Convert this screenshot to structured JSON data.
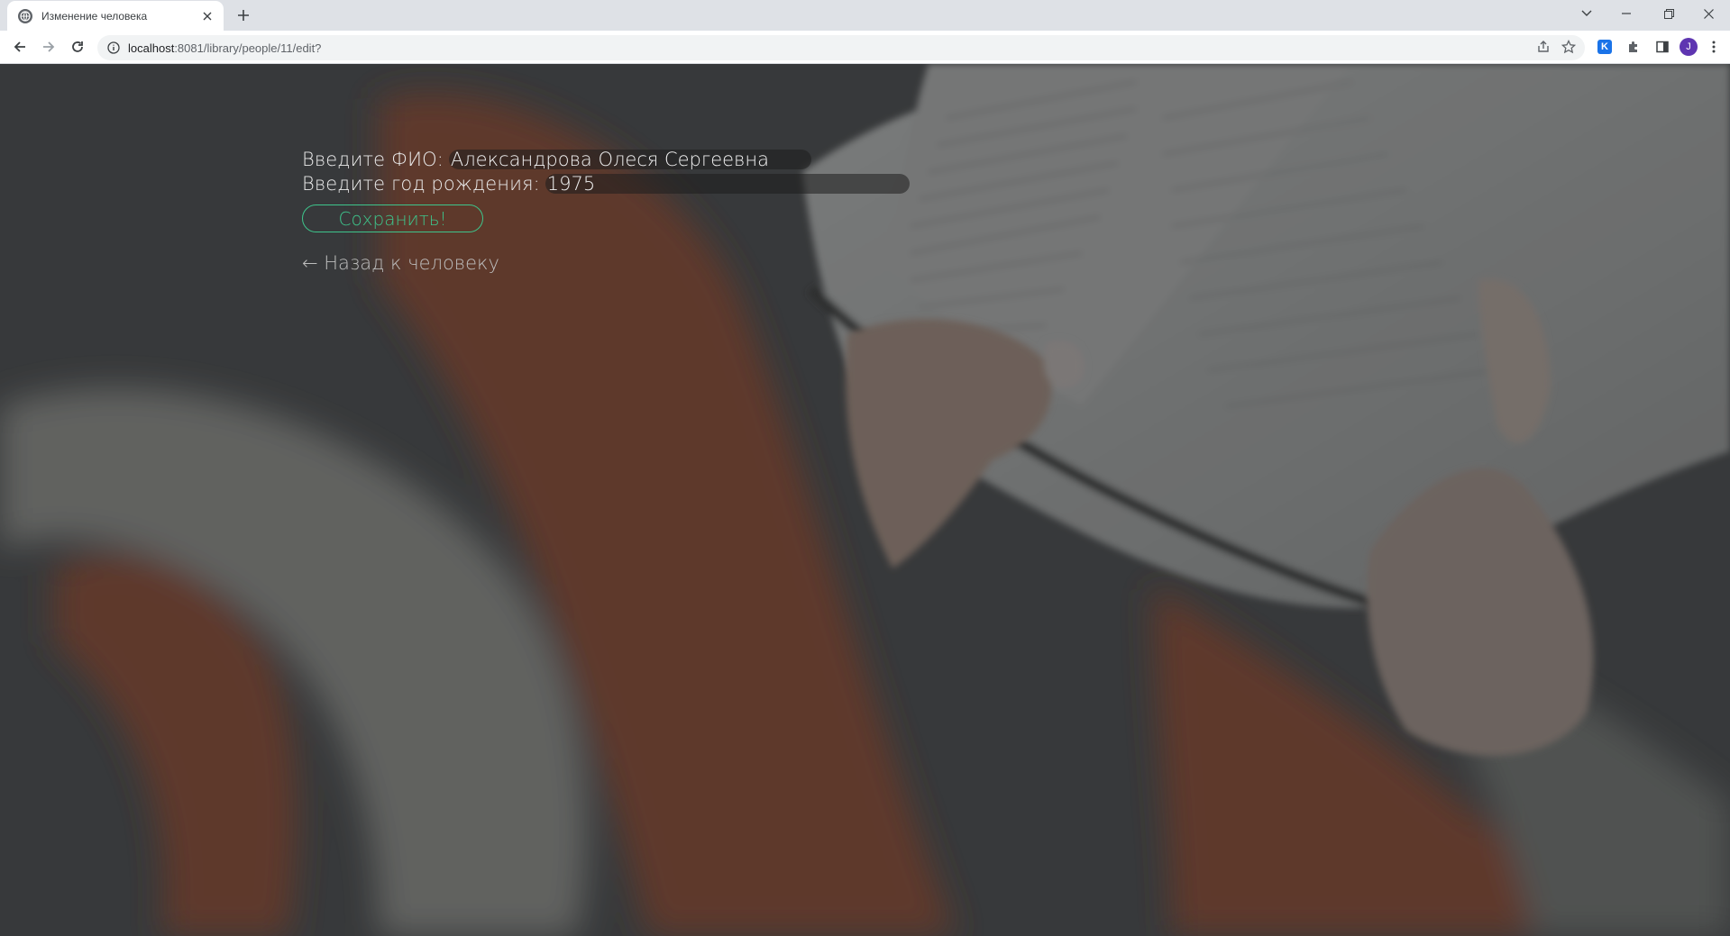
{
  "browser": {
    "tab": {
      "title": "Изменение человека"
    },
    "address": {
      "host": "localhost",
      "rest": ":8081/library/people/11/edit?"
    },
    "profile_initial": "J",
    "extension_letter": "K"
  },
  "form": {
    "fio_label": "Введите ФИО:",
    "fio_value": "Александрова Олеся Сергеевна",
    "year_label": "Введите год рождения:",
    "year_value": "1975",
    "save_label": "Сохранить!",
    "back_link": "← Назад к человеку"
  },
  "colors": {
    "accent": "#3ec58c",
    "overlay": "#3b3c3e"
  }
}
